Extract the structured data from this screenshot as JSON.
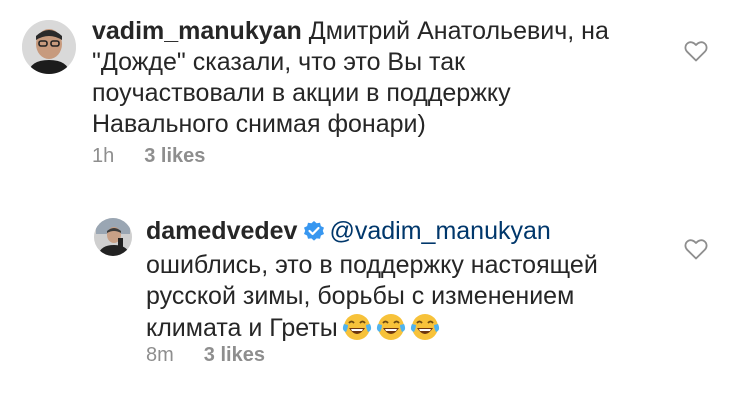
{
  "comments": [
    {
      "username": "vadim_manukyan",
      "text_lines": [
        "Дмитрий Анатольевич, на",
        "\"Дожде\" сказали, что это Вы так",
        "поучаствовали в акции в поддержку",
        "Навального снимая фонари)"
      ],
      "time": "1h",
      "likes": "3 likes",
      "icon": "heart-outline-icon"
    },
    {
      "username": "damedvedev",
      "verified": true,
      "mention": "@vadim_manukyan",
      "text_lines": [
        "ошиблись, это в поддержку настоящей",
        "русской зимы, борьбы с изменением",
        "климата и Греты"
      ],
      "emojis": [
        "face-with-tears-of-joy",
        "face-with-tears-of-joy",
        "face-with-tears-of-joy"
      ],
      "time": "8m",
      "likes": "3 likes",
      "icon": "heart-outline-icon"
    }
  ],
  "colors": {
    "text": "#262626",
    "secondary": "#8e8e8e",
    "verified": "#3897f0",
    "mention": "#00376b"
  }
}
